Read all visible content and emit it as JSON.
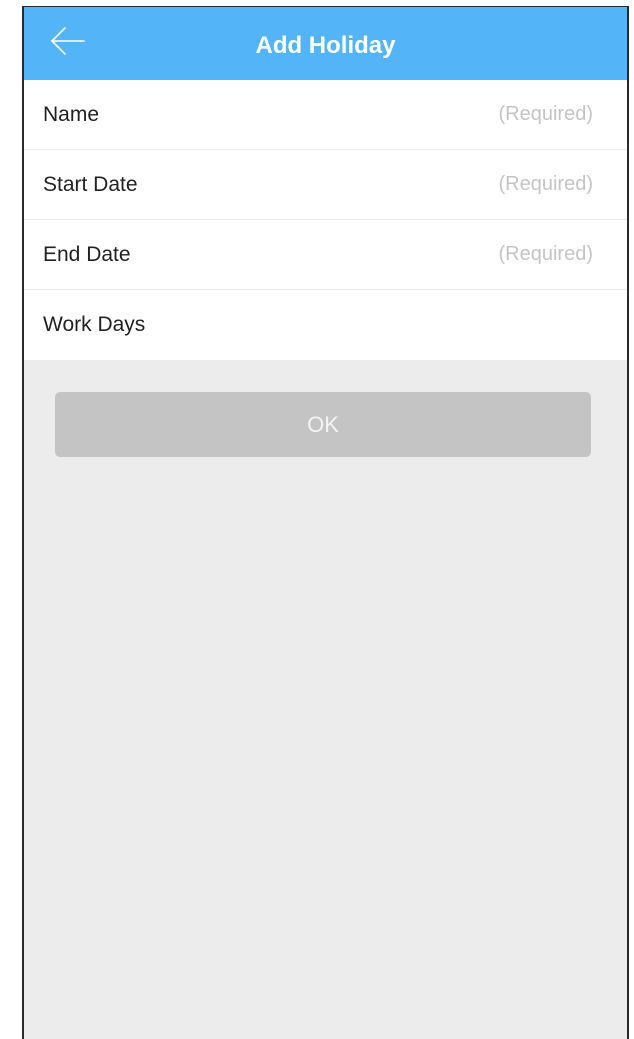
{
  "header": {
    "title": "Add Holiday",
    "back_icon": "arrow-left-icon"
  },
  "form": {
    "rows": [
      {
        "label": "Name",
        "value": "(Required)"
      },
      {
        "label": "Start Date",
        "value": "(Required)"
      },
      {
        "label": "End Date",
        "value": "(Required)"
      },
      {
        "label": "Work Days",
        "value": ""
      }
    ]
  },
  "actions": {
    "ok_label": "OK",
    "ok_enabled": false
  },
  "colors": {
    "navbar": "#53b4f7",
    "background": "#ececec",
    "button_disabled": "#c4c4c4",
    "placeholder_text": "#c4c4c4"
  }
}
